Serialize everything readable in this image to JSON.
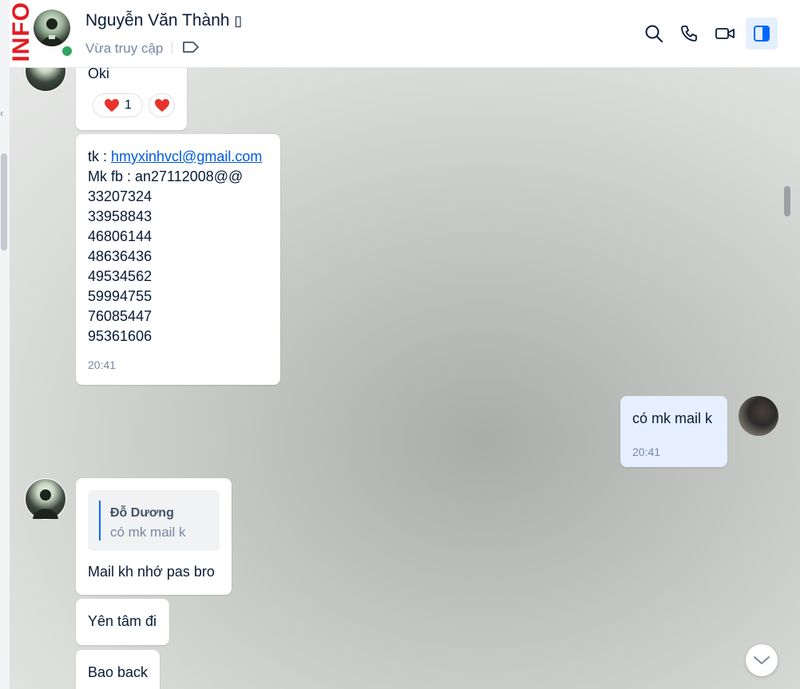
{
  "watermark": "INFO",
  "header": {
    "name": "Nguyễn Văn Thành",
    "name_suffix_glyph": "▯",
    "status": "Vừa truy cập"
  },
  "messages": {
    "oki": "Oki",
    "reaction_count": "1",
    "account": {
      "tk_label": "tk : ",
      "tk_email": "hmyxinhvcl@gmail.com",
      "mk_line": "Mk fb : an27112008@@",
      "codes": [
        "33207324",
        "33958843",
        "46806144",
        "48636436",
        "49534562",
        "59994755",
        "76085447",
        "95361606"
      ],
      "time": "20:41"
    },
    "outgoing": {
      "text": "có mk mail k",
      "time": "20:41"
    },
    "reply": {
      "quote_name": "Đỗ Dương",
      "quote_text": "có mk mail k",
      "text": "Mail kh nhớ pas bro"
    },
    "yen_tam": "Yên tâm đi",
    "bao_back": "Bao back"
  }
}
